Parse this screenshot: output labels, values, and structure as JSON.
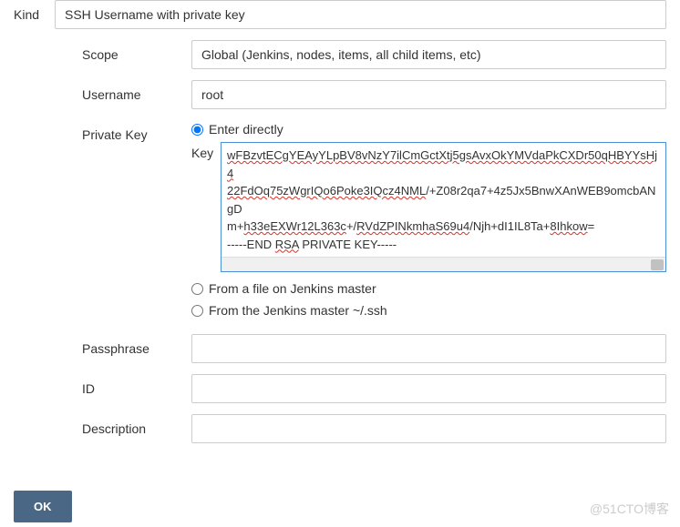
{
  "kind": {
    "label": "Kind",
    "value": "SSH Username with private key"
  },
  "scope": {
    "label": "Scope",
    "value": "Global (Jenkins, nodes, items, all child items, etc)"
  },
  "username": {
    "label": "Username",
    "value": "root"
  },
  "privateKey": {
    "label": "Private Key",
    "options": {
      "enterDirectly": "Enter directly",
      "fromFile": "From a file on Jenkins master",
      "fromSsh": "From the Jenkins master ~/.ssh"
    },
    "keyLabel": "Key",
    "keyLine1": "wFBzvtECgYEAyYLpBV8vNzY7ilCmGctXtj5gsAvxOkYMVdaPkCXDr50qHBYYsHj4",
    "keyLine2a": "22FdOq75zWgrIQo6Poke3IQcz4NML",
    "keyLine2b": "/+Z08r2qa7+4z5Jx5BnwXAnWEB9omcbANgD",
    "keyLine3a": "m+",
    "keyLine3b": "h33eEXWr12L363c",
    "keyLine3c": "+/",
    "keyLine3d": "RVdZPINkmhaS69u4",
    "keyLine3e": "/Njh+dI1IL8Ta+",
    "keyLine3f": "8Ihkow",
    "keyLine3g": "=",
    "keyLine4a": "-----END ",
    "keyLine4b": "RSA",
    "keyLine4c": " PRIVATE KEY-----"
  },
  "passphrase": {
    "label": "Passphrase",
    "value": ""
  },
  "id": {
    "label": "ID",
    "value": ""
  },
  "description": {
    "label": "Description",
    "value": ""
  },
  "okButton": "OK",
  "watermark": "@51CTO博客"
}
